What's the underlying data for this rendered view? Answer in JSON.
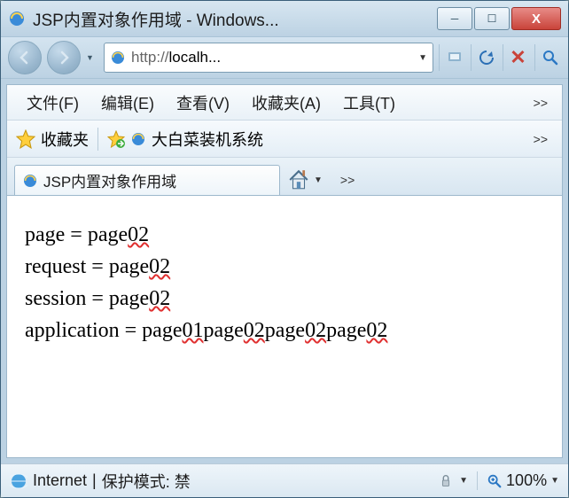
{
  "window": {
    "title": "JSP内置对象作用域 - Windows..."
  },
  "address": {
    "scheme": "http://",
    "host": "localh..."
  },
  "menu": {
    "file": "文件(F)",
    "edit": "编辑(E)",
    "view": "查看(V)",
    "favorites": "收藏夹(A)",
    "tools": "工具(T)"
  },
  "favbar": {
    "label": "收藏夹",
    "bookmark1": "大白菜装机系统"
  },
  "tab": {
    "title": "JSP内置对象作用域"
  },
  "content": {
    "line1_a": "page = page",
    "line1_b": "02",
    "line2_a": "request = page",
    "line2_b": "02",
    "line3_a": "session = page",
    "line3_b": "02",
    "line4_a": "application = page",
    "line4_b": "01",
    "line4_c": "page",
    "line4_d": "02",
    "line4_e": "page",
    "line4_f": "02",
    "line4_g": "page",
    "line4_h": "02"
  },
  "status": {
    "zone": "Internet",
    "sep": " | ",
    "mode": "保护模式: 禁",
    "zoom": "100%"
  },
  "glyphs": {
    "more": ">>",
    "dropdown": "▼",
    "minus": "─",
    "square": "☐",
    "close": "X"
  }
}
